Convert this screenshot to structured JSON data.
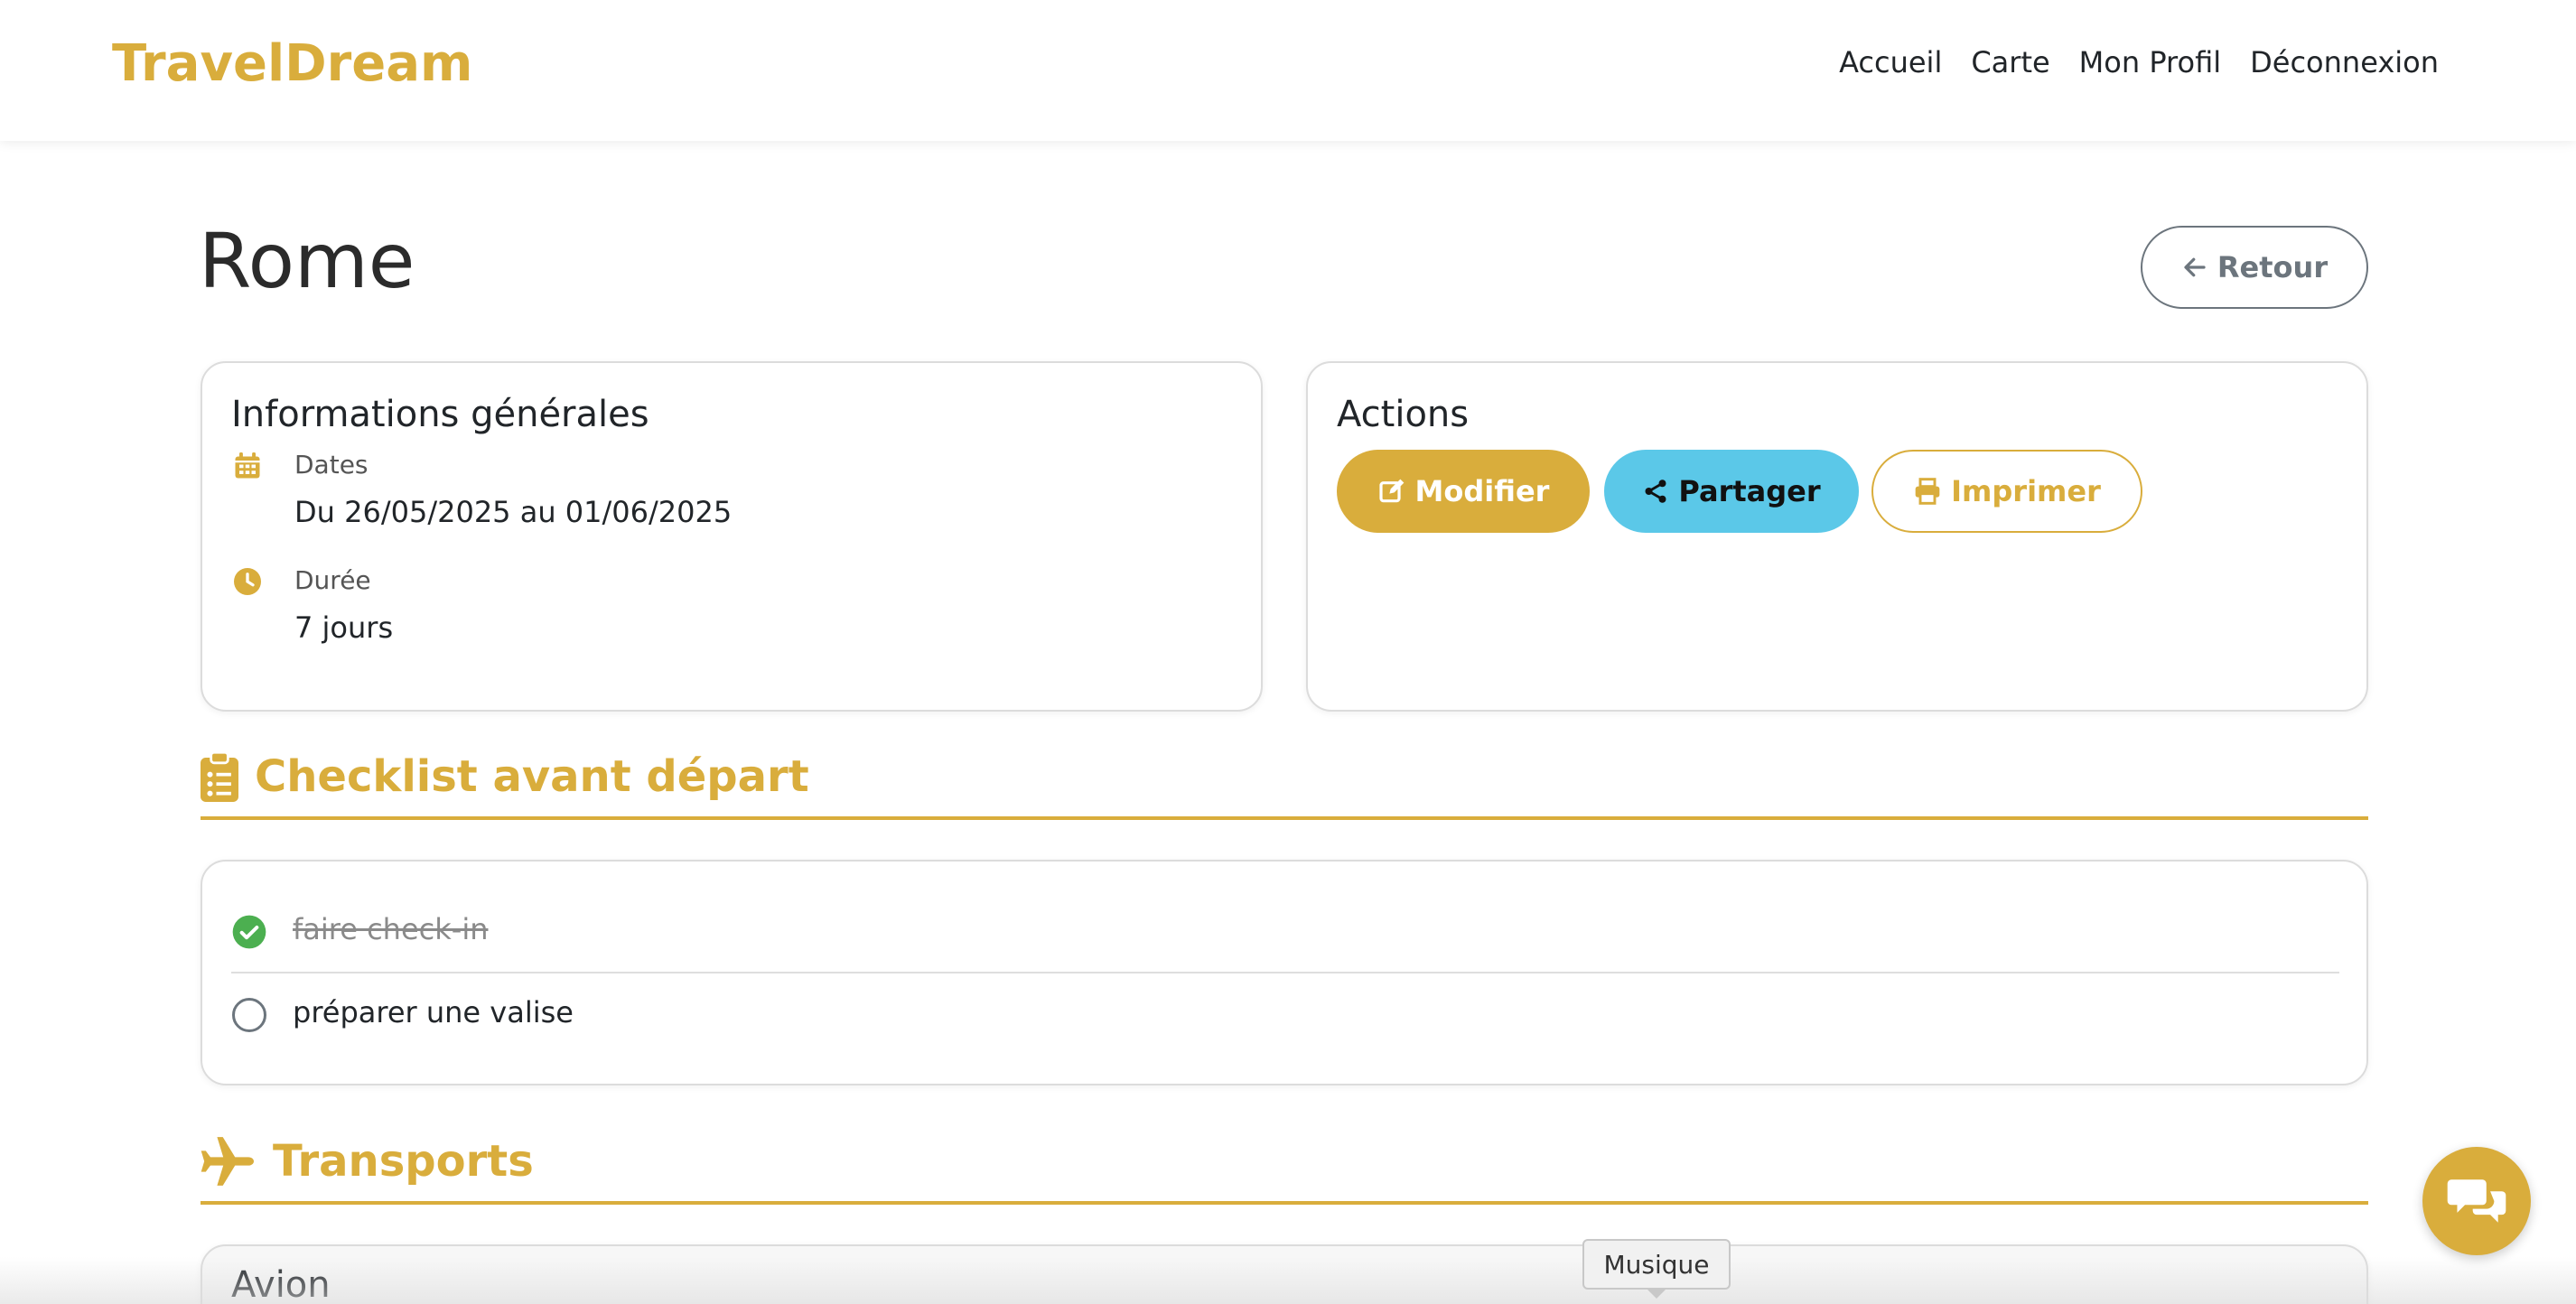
{
  "navbar": {
    "brand": "TravelDream",
    "links": [
      "Accueil",
      "Carte",
      "Mon Profil",
      "Déconnexion"
    ]
  },
  "page": {
    "title": "Rome",
    "back_label": "Retour"
  },
  "info_card": {
    "title": "Informations générales",
    "dates_label": "Dates",
    "dates_value": "Du 26/05/2025 au 01/06/2025",
    "duration_label": "Durée",
    "duration_value": "7 jours"
  },
  "actions_card": {
    "title": "Actions",
    "modify_label": "Modifier",
    "share_label": "Partager",
    "print_label": "Imprimer"
  },
  "checklist": {
    "title": "Checklist avant départ",
    "items": [
      {
        "text": "faire check-in",
        "done": true
      },
      {
        "text": "préparer une valise",
        "done": false
      }
    ]
  },
  "transports": {
    "title": "Transports",
    "first_card_title": "Avion"
  },
  "tooltip": {
    "text": "Musique"
  },
  "colors": {
    "accent": "#d9ad3c",
    "info": "#5bc8e8",
    "success": "#4caf50",
    "secondary": "#6c757d"
  }
}
